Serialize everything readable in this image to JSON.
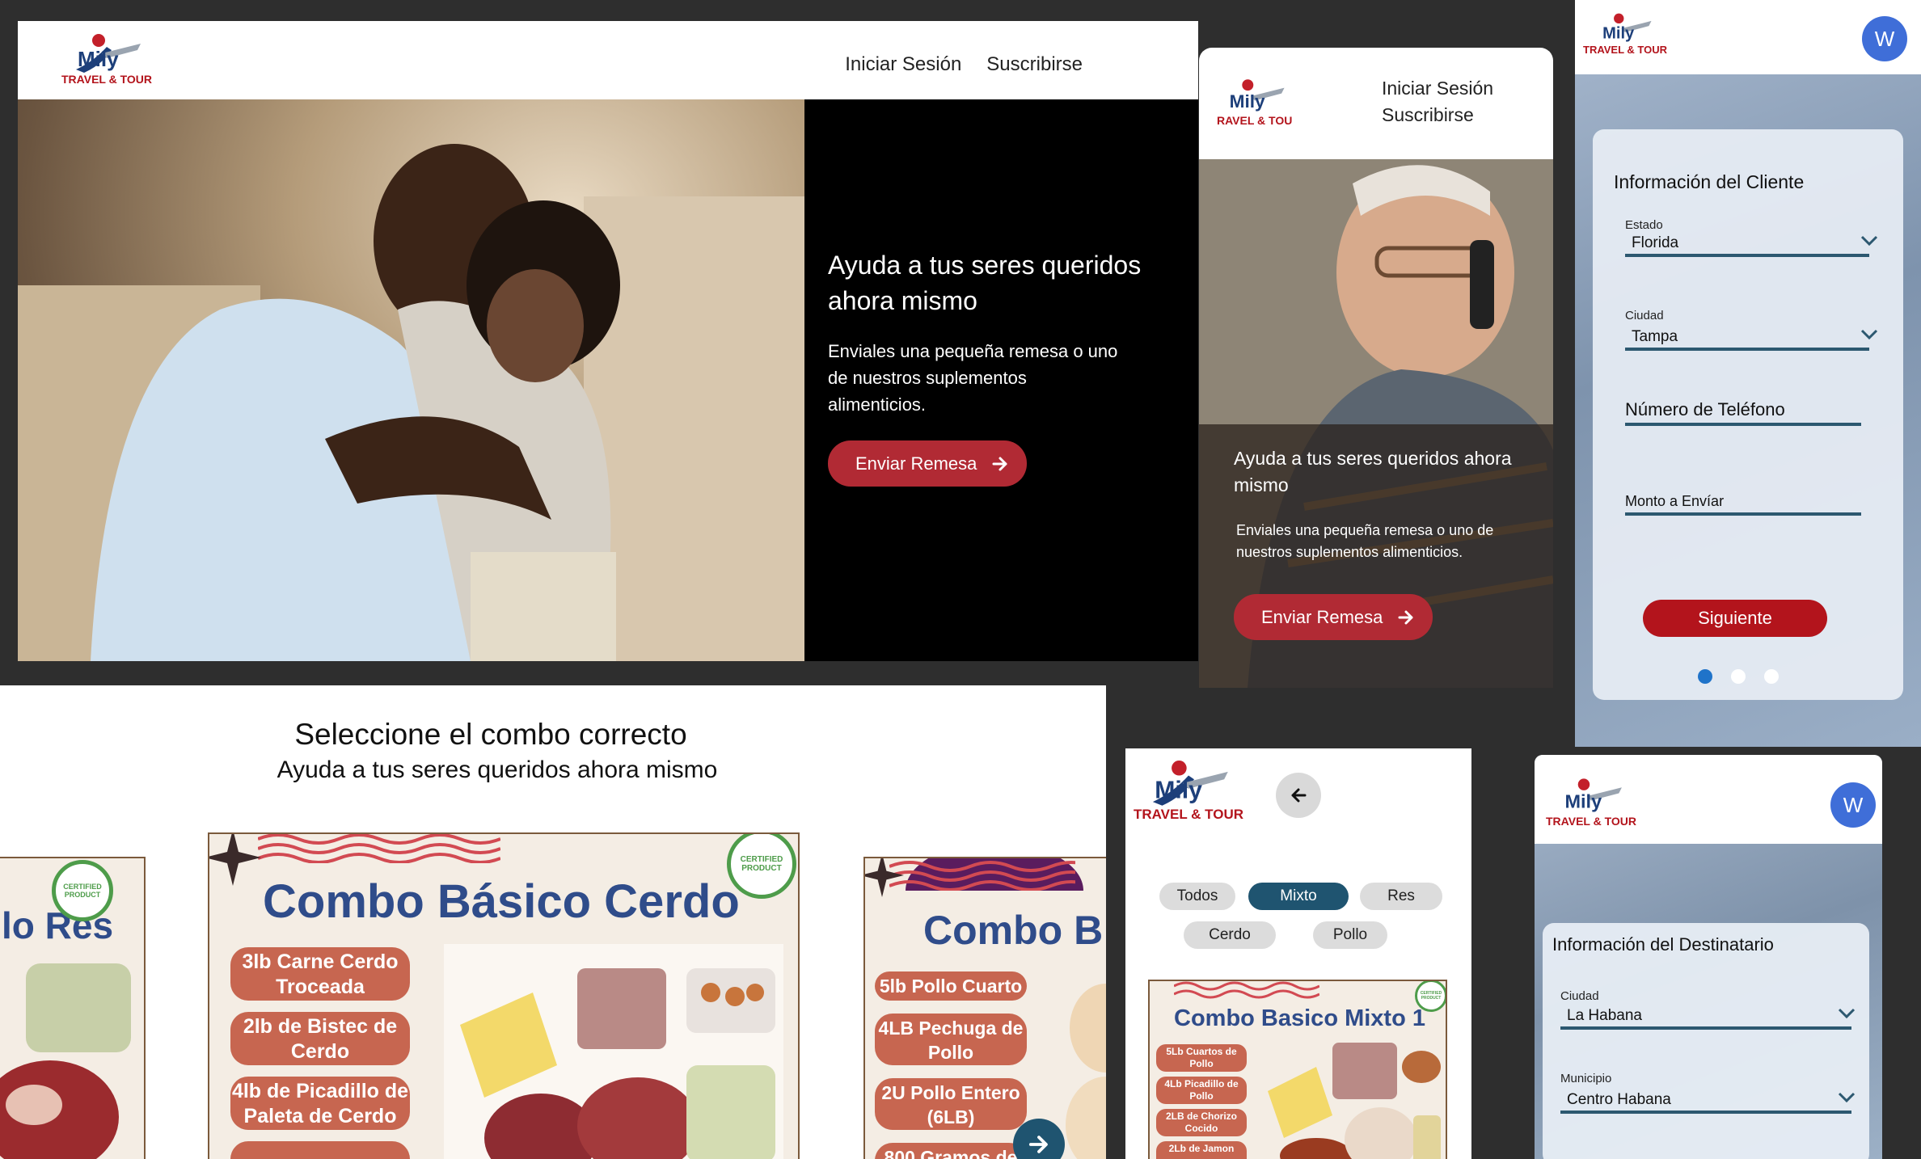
{
  "brand": {
    "logo_text": "TRAVEL & TOUR",
    "logo_text_cropped": "RAVEL & TOU",
    "logo_mark": "Mily"
  },
  "desktop": {
    "nav": {
      "login": "Iniciar Sesión",
      "subscribe": "Suscribirse"
    },
    "hero": {
      "title": "Ayuda a tus seres queridos ahora mismo",
      "body": "Enviales una pequeña remesa o uno de nuestros suplementos alimenticios.",
      "cta": "Enviar Remesa"
    }
  },
  "tablet": {
    "nav": {
      "login": "Iniciar Sesión",
      "subscribe": "Suscribirse"
    },
    "hero": {
      "title": "Ayuda a tus seres queridos ahora mismo",
      "body": "Enviales una pequeña remesa o uno de nuestros suplementos alimenticios.",
      "cta": "Enviar Remesa"
    }
  },
  "client_form": {
    "avatar": "W",
    "title": "Información del Cliente",
    "estado_label": "Estado",
    "estado_value": "Florida",
    "ciudad_label": "Ciudad",
    "ciudad_value": "Tampa",
    "phone_placeholder": "Número de Teléfono",
    "amount_placeholder": "Monto a Envíar",
    "next": "Siguiente",
    "step": 1,
    "steps": 3
  },
  "combos": {
    "title": "Seleccione el combo correcto",
    "subtitle": "Ayuda a tus seres queridos ahora mismo",
    "badge": "CERTIFIED PRODUCT",
    "left": {
      "title": "lo Res"
    },
    "center": {
      "title": "Combo Básico Cerdo",
      "items": [
        "3lb Carne Cerdo Troceada",
        "2lb de Bistec de Cerdo",
        "4lb de Picadillo de Paleta de Cerdo"
      ]
    },
    "right": {
      "title": "Combo B",
      "items": [
        "5lb Pollo Cuarto",
        "4LB Pechuga de Pollo",
        "2U Pollo Entero (6LB)",
        "800 Gramos de"
      ]
    }
  },
  "mixto": {
    "filters": [
      "Todos",
      "Mixto",
      "Res",
      "Cerdo",
      "Pollo"
    ],
    "active_filter": "Mixto",
    "poster_title": "Combo Basico Mixto 1",
    "items": [
      "5Lb Cuartos de Pollo",
      "4Lb Picadillo de Pollo",
      "2LB de Chorizo Cocido",
      "2Lb de Jamon"
    ]
  },
  "recipient_form": {
    "avatar": "W",
    "title": "Información del Destinatario",
    "ciudad_label": "Ciudad",
    "ciudad_value": "La Habana",
    "municipio_label": "Municipio",
    "municipio_value": "Centro Habana"
  },
  "colors": {
    "accent_red": "#b12a34",
    "teal": "#1f5470",
    "title_blue": "#2f4c8a",
    "avatar_blue": "#3f6ed8"
  }
}
